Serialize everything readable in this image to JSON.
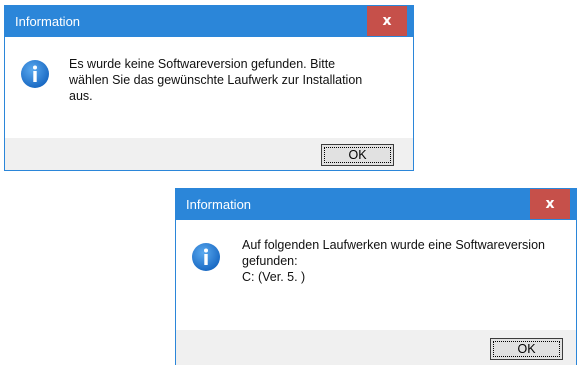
{
  "dialogs": [
    {
      "title": "Information",
      "close_label": "x",
      "icon": "info-icon",
      "message": "Es wurde keine Softwareversion gefunden. Bitte\nwählen Sie das gewünschte Laufwerk zur Installation\naus.",
      "ok_label": "OK"
    },
    {
      "title": "Information",
      "close_label": "x",
      "icon": "info-icon",
      "message": "Auf folgenden Laufwerken wurde eine Softwareversion\ngefunden:\nC:  (Ver. 5.           )",
      "ok_label": "OK"
    }
  ],
  "colors": {
    "titlebar": "#2b86d9",
    "close_button": "#c6504a",
    "icon": "#1e78cf",
    "dialog_bg": "#f0f0f0"
  }
}
